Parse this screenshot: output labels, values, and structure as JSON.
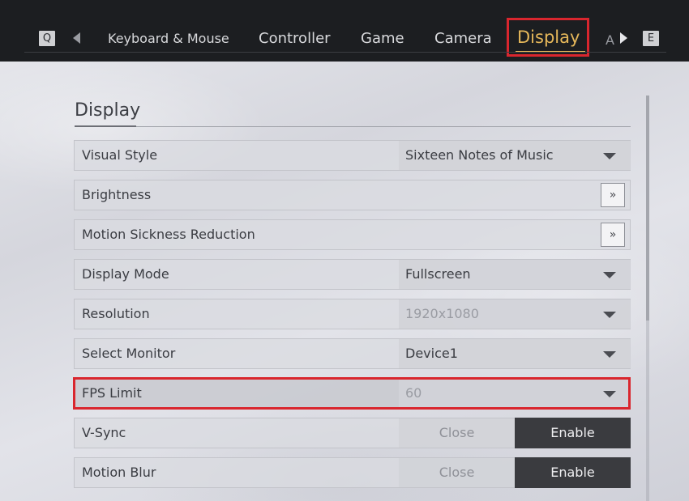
{
  "nav": {
    "left_key": "Q",
    "right_key": "E",
    "overflow": "A",
    "tabs": [
      {
        "label": "Keyboard & Mouse"
      },
      {
        "label": "Controller"
      },
      {
        "label": "Game"
      },
      {
        "label": "Camera"
      },
      {
        "label": "Display"
      }
    ],
    "active_tab": "Display",
    "active_color": "#e5b75a",
    "highlight_color": "#d9262e"
  },
  "section": {
    "title": "Display"
  },
  "settings": [
    {
      "label": "Visual Style",
      "control": "select",
      "value": "Sixteen Notes of Music"
    },
    {
      "label": "Brightness",
      "control": "button",
      "button_label": "»"
    },
    {
      "label": "Motion Sickness Reduction",
      "control": "button",
      "button_label": "»"
    },
    {
      "label": "Display Mode",
      "control": "select",
      "value": "Fullscreen"
    },
    {
      "label": "Resolution",
      "control": "select",
      "value": "1920x1080",
      "disabled": true
    },
    {
      "label": "Select Monitor",
      "control": "select",
      "value": "Device1"
    },
    {
      "label": "FPS Limit",
      "control": "select",
      "value": "60",
      "disabled": true,
      "highlighted": true
    },
    {
      "label": "V-Sync",
      "control": "toggle",
      "off_label": "Close",
      "on_label": "Enable",
      "selected": "Enable"
    },
    {
      "label": "Motion Blur",
      "control": "toggle",
      "off_label": "Close",
      "on_label": "Enable",
      "selected": "Enable"
    }
  ]
}
